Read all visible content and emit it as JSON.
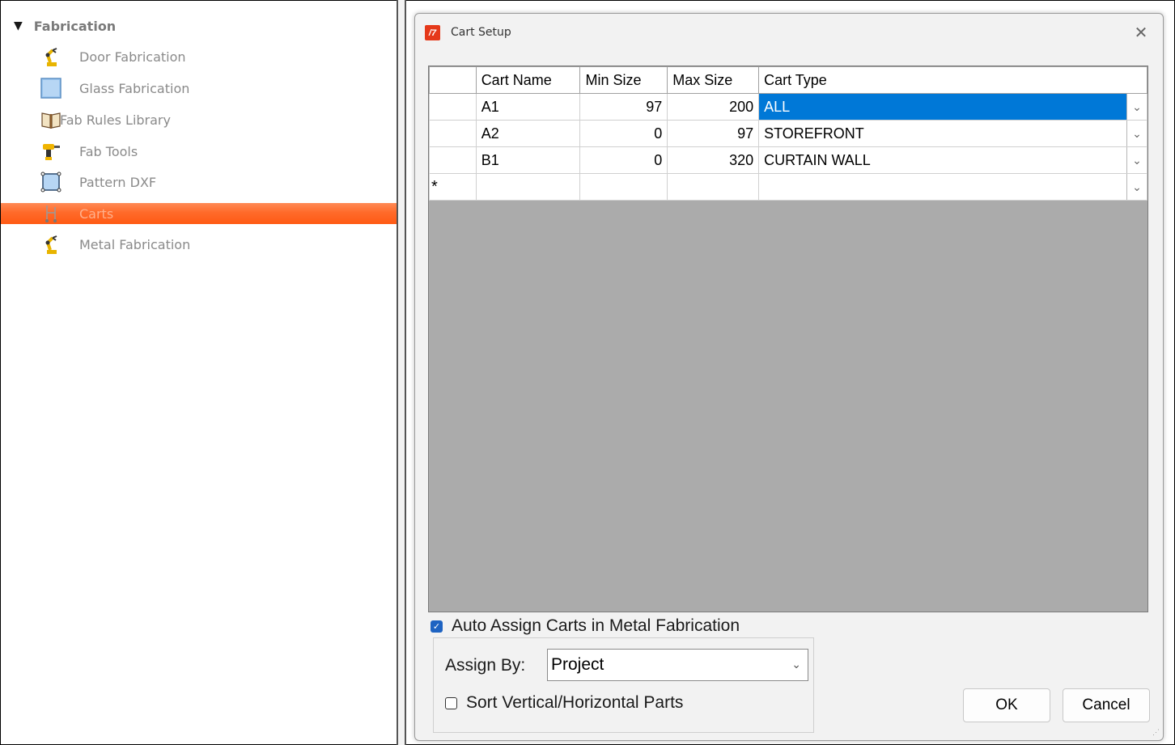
{
  "tree": {
    "header": "Fabrication",
    "items": [
      {
        "label": "Door Fabrication",
        "icon": "robot-arm-icon"
      },
      {
        "label": "Glass Fabrication",
        "icon": "glass-pane-icon"
      },
      {
        "label": "Fab Rules Library",
        "icon": "open-book-icon"
      },
      {
        "label": "Fab Tools",
        "icon": "drill-icon"
      },
      {
        "label": "Pattern DXF",
        "icon": "pattern-square-icon"
      },
      {
        "label": "Carts",
        "icon": "cart-icon",
        "selected": true
      },
      {
        "label": "Metal Fabrication",
        "icon": "robot-arm-icon"
      }
    ]
  },
  "dialog": {
    "title": "Cart Setup",
    "close_symbol": "✕",
    "columns": [
      "Cart Name",
      "Min Size",
      "Max Size",
      "Cart Type"
    ],
    "rows": [
      {
        "name": "A1",
        "min": "97",
        "max": "200",
        "type": "ALL",
        "selected": true
      },
      {
        "name": "A2",
        "min": "0",
        "max": "97",
        "type": "STOREFRONT"
      },
      {
        "name": "B1",
        "min": "0",
        "max": "320",
        "type": "CURTAIN WALL"
      }
    ],
    "new_row_marker": "*",
    "auto_assign_label": "Auto Assign Carts in Metal Fabrication",
    "auto_assign_checked": true,
    "assign_by_label": "Assign By:",
    "assign_by_value": "Project",
    "sort_label": "Sort Vertical/Horizontal Parts",
    "sort_checked": false,
    "ok_label": "OK",
    "cancel_label": "Cancel"
  },
  "colors": {
    "selection_orange": "#ff6a2a",
    "selection_blue": "#0078d7",
    "checkbox_blue": "#1e63c2",
    "grid_empty": "#ababab"
  }
}
